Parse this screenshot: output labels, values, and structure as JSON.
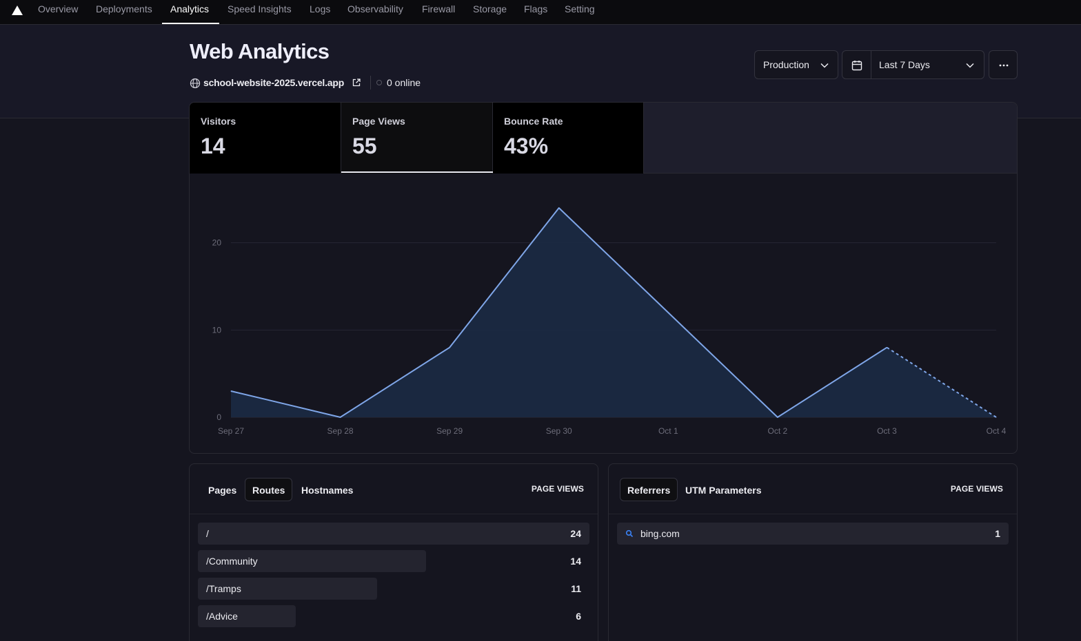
{
  "nav": {
    "items": [
      "Overview",
      "Deployments",
      "Analytics",
      "Speed Insights",
      "Logs",
      "Observability",
      "Firewall",
      "Storage",
      "Flags",
      "Setting"
    ],
    "active": "Analytics"
  },
  "header": {
    "title": "Web Analytics",
    "site": "school-website-2025.vercel.app",
    "online": "0 online"
  },
  "controls": {
    "environment": "Production",
    "date_range": "Last 7 Days"
  },
  "metrics": [
    {
      "label": "Visitors",
      "value": "14"
    },
    {
      "label": "Page Views",
      "value": "55"
    },
    {
      "label": "Bounce Rate",
      "value": "43%"
    }
  ],
  "selected_metric": "Page Views",
  "chart_data": {
    "type": "area",
    "x": [
      "Sep 27",
      "Sep 28",
      "Sep 29",
      "Sep 30",
      "Oct 1",
      "Oct 2",
      "Oct 3",
      "Oct 4"
    ],
    "series": [
      {
        "values": [
          3,
          0,
          8,
          24,
          12,
          0,
          8,
          0
        ]
      }
    ],
    "ylim": [
      0,
      24
    ],
    "yticks": [
      0,
      10,
      20
    ],
    "dashed_last_segment": true,
    "grid": true,
    "colors": {
      "line": "#7fa6e8",
      "fill": "#1b2a44"
    }
  },
  "pages_panel": {
    "tabs": [
      "Pages",
      "Routes",
      "Hostnames"
    ],
    "active_tab": "Routes",
    "column": "PAGE VIEWS",
    "rows": [
      {
        "label": "/",
        "value": "24",
        "share": 1.0
      },
      {
        "label": "/Community",
        "value": "14",
        "share": 0.583
      },
      {
        "label": "/Tramps",
        "value": "11",
        "share": 0.458
      },
      {
        "label": "/Advice",
        "value": "6",
        "share": 0.25
      }
    ]
  },
  "referrers_panel": {
    "tabs": [
      "Referrers",
      "UTM Parameters"
    ],
    "active_tab": "Referrers",
    "column": "PAGE VIEWS",
    "rows": [
      {
        "label": "bing.com",
        "value": "1",
        "share": 1.0,
        "icon": "search-icon"
      }
    ]
  }
}
